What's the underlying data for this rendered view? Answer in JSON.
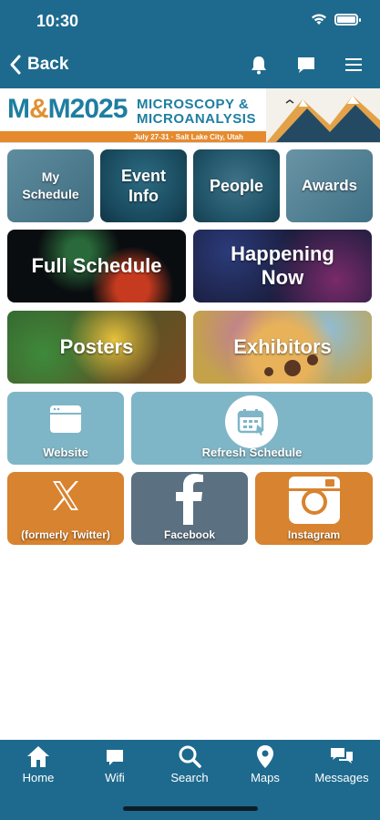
{
  "status_bar": {
    "time": "10:30"
  },
  "nav": {
    "back_label": "Back"
  },
  "banner": {
    "logo_m1": "M",
    "logo_amp": "&",
    "logo_m2": "M2025",
    "title_line1": "MICROSCOPY &",
    "title_line2": "MICROANALYSIS",
    "date_location": "July 27-31 · Salt Lake City, Utah"
  },
  "tiles": {
    "my_schedule": "My Schedule",
    "event_info": "Event Info",
    "people": "People",
    "awards": "Awards",
    "full_schedule": "Full Schedule",
    "happening_now": "Happening Now",
    "posters": "Posters",
    "exhibitors": "Exhibitors",
    "website": "Website",
    "refresh_schedule": "Refresh Schedule",
    "twitter": "(formerly Twitter)",
    "facebook": "Facebook",
    "instagram": "Instagram"
  },
  "tabbar": {
    "home": "Home",
    "wifi": "Wifi",
    "search": "Search",
    "maps": "Maps",
    "messages": "Messages"
  },
  "colors": {
    "nav_bg": "#1e6a8e",
    "accent_orange": "#d8832f",
    "tile_light_blue": "#7fb6c7",
    "facebook_gray": "#5b7080"
  }
}
